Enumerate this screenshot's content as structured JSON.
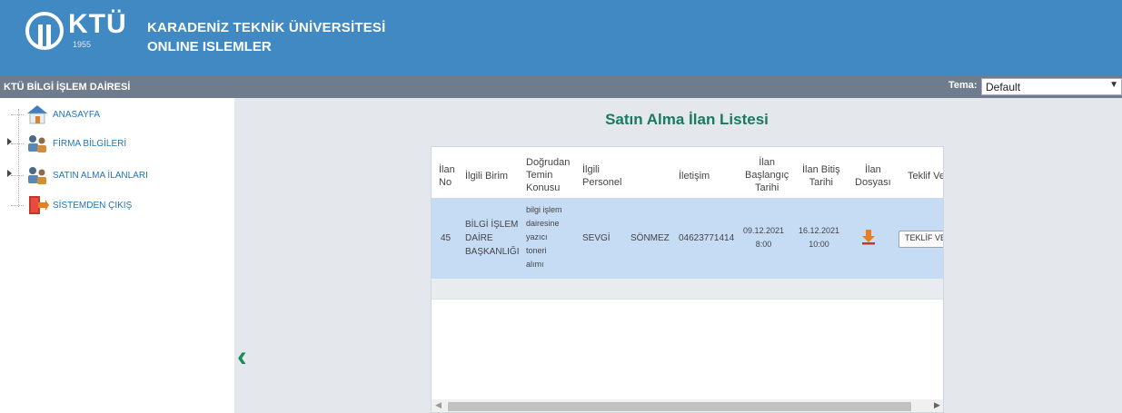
{
  "header": {
    "logo_text": "KTÜ",
    "logo_year": "1955",
    "university": "KARADENİZ TEKNİK ÜNİVERSİTESİ",
    "subtitle": "ONLINE ISLEMLER"
  },
  "subbar": {
    "department": "KTÜ BİLGİ İŞLEM DAİRESİ",
    "theme_label": "Tema:",
    "theme_value": "Default"
  },
  "sidebar": {
    "items": [
      {
        "label": "ANASAYFA",
        "icon": "home-icon"
      },
      {
        "label": "FİRMA BİLGİLERİ",
        "icon": "users-icon"
      },
      {
        "label": "SATIN ALMA İLANLARI",
        "icon": "users-icon"
      },
      {
        "label": "SİSTEMDEN ÇIKIŞ",
        "icon": "exit-icon"
      }
    ]
  },
  "main": {
    "title": "Satın Alma İlan Listesi",
    "columns": {
      "ilan_no": [
        "İlan",
        "No"
      ],
      "birim": [
        "İlgili Birim"
      ],
      "konu": [
        "Doğrudan",
        "Temin",
        "Konusu"
      ],
      "personel": [
        "İlgili",
        "Personel"
      ],
      "iletisim": [
        "İletişim"
      ],
      "baslangic": [
        "İlan",
        "Başlangıç",
        "Tarihi"
      ],
      "bitis": [
        "İlan Bitiş",
        "Tarihi"
      ],
      "dosya": [
        "İlan",
        "Dosyası"
      ],
      "teklif": [
        "Teklif Ve"
      ]
    },
    "row": {
      "ilan_no": "45",
      "birim": [
        "BİLGİ İŞLEM",
        "DAİRE",
        "BAŞKANLIĞI"
      ],
      "konu": [
        "bilgi işlem",
        "dairesine",
        "yazıcı",
        "toneri",
        "alımı"
      ],
      "personel_ad": "SEVGİ",
      "personel_soyad": "SÖNMEZ",
      "iletisim": "04623771414",
      "baslangic": [
        "09.12.2021",
        "8:00"
      ],
      "bitis": [
        "16.12.2021",
        "10:00"
      ],
      "teklif_button": "TEKLİF VE"
    }
  },
  "colors": {
    "header_bg": "#4189c2",
    "subbar_bg": "#6f7c8d",
    "title_green": "#1a7a5c",
    "row_selected": "#c6dcf5",
    "link_blue": "#1e73be"
  }
}
